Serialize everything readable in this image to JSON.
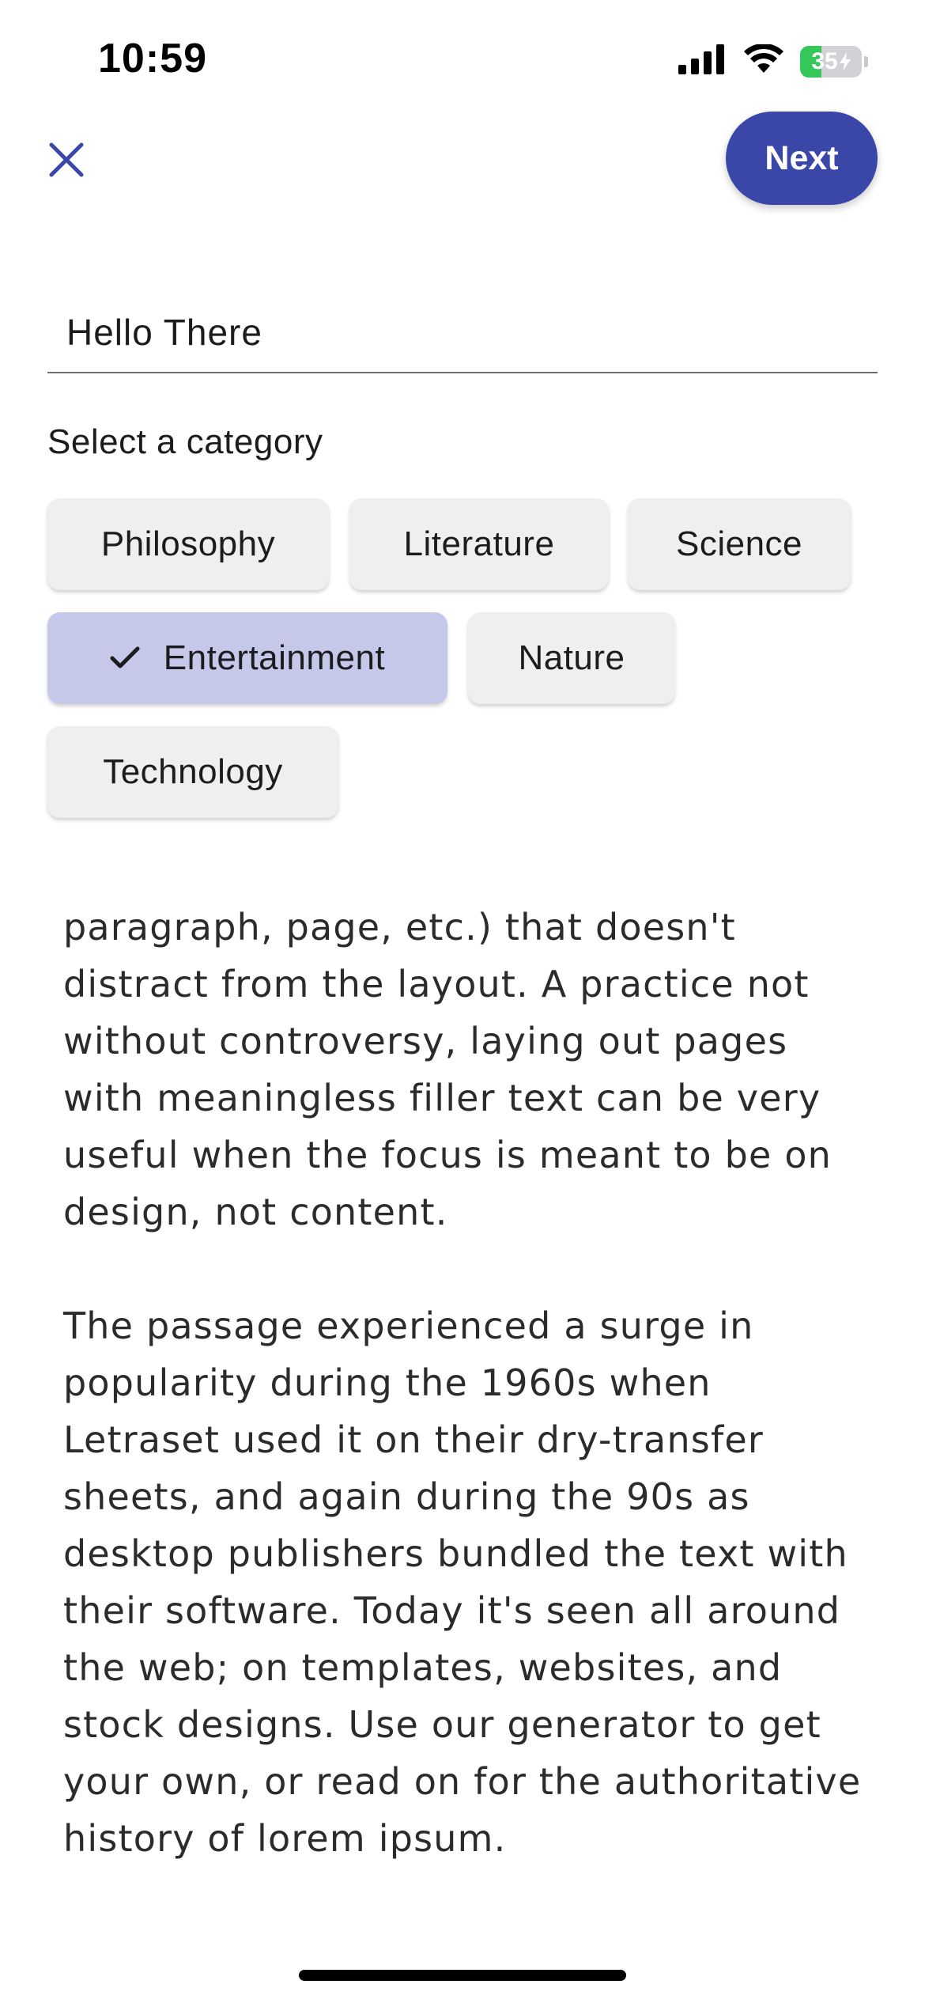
{
  "status_bar": {
    "time": "10:59",
    "battery_level": "35",
    "icons": [
      "signal-icon",
      "wifi-icon",
      "battery-charging-icon"
    ]
  },
  "header": {
    "close_icon": "close-icon",
    "next_label": "Next"
  },
  "title_field": {
    "value": "Hello There"
  },
  "category": {
    "label": "Select a category",
    "chips": [
      {
        "label": "Philosophy",
        "selected": false
      },
      {
        "label": "Literature",
        "selected": false
      },
      {
        "label": "Science",
        "selected": false
      },
      {
        "label": "Entertainment",
        "selected": true
      },
      {
        "label": "Nature",
        "selected": false
      },
      {
        "label": "Technology",
        "selected": false
      }
    ]
  },
  "content": {
    "paragraphs": [
      "paragraph, page, etc.) that doesn't\ndistract from the layout. A practice not\nwithout controversy, laying out pages\nwith meaningless filler text can be very\nuseful when the focus is meant to be on\ndesign, not content.",
      "The passage experienced a surge in\npopularity during the 1960s when\nLetraset used it on their dry-transfer\nsheets, and again during the 90s as\ndesktop publishers bundled the text with\ntheir software. Today it's seen all around\nthe web; on templates, websites, and\nstock designs. Use our generator to get\nyour own, or read on for the authoritative\nhistory of lorem ipsum."
    ]
  },
  "colors": {
    "accent": "#3a46a8",
    "chip_bg": "#efeff1",
    "chip_selected_bg": "#c5c8e8",
    "battery_green": "#34c759"
  }
}
